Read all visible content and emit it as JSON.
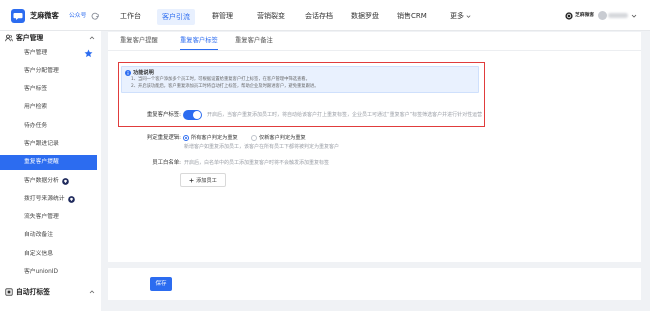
{
  "theme": {
    "accent": "#2c6cf0",
    "accent_light": "#e8f0fe",
    "annotation_red": "#e03c3c",
    "gem_color": "#1f2a5c",
    "notice_bg": "#e9f1fe"
  },
  "app": {
    "logo_icon": "chat-bubble-icon",
    "name": "芝麻微客",
    "badge": "公众号",
    "switch_icon": "switch-icon"
  },
  "header": {
    "nav": [
      {
        "label": "工作台",
        "active": false
      },
      {
        "label": "客户引流",
        "active": true
      },
      {
        "label": "群管理",
        "active": false
      },
      {
        "label": "营销裂变",
        "active": false
      },
      {
        "label": "会话存档",
        "active": false
      },
      {
        "label": "数据罗盘",
        "active": false
      },
      {
        "label": "销售CRM",
        "active": false
      },
      {
        "label": "更多",
        "active": false,
        "icon": "chevron-down-icon"
      }
    ],
    "account": {
      "icon": "org-badge-icon",
      "org_name": "芝麻微客",
      "avatar": "avatar",
      "dropdown_icon": "chevron-down-icon"
    }
  },
  "sidebar": {
    "section": {
      "title": "客户管理",
      "icon": "users-icon",
      "expanded": true,
      "toggle_icon": "chevron-up-icon"
    },
    "items": [
      {
        "label": "客户管理",
        "icon": "star-icon",
        "active": false
      },
      {
        "label": "客户分配管理",
        "active": false
      },
      {
        "label": "客户标签",
        "active": false
      },
      {
        "label": "用户检索",
        "active": false
      },
      {
        "label": "待办任务",
        "active": false
      },
      {
        "label": "客户跟进记录",
        "active": false
      },
      {
        "label": "重复客户提醒",
        "active": true
      },
      {
        "label": "客户数据分析",
        "icon": "gem-icon",
        "active": false
      },
      {
        "label": "拨打号来源统计",
        "icon": "gem-icon",
        "active": false
      },
      {
        "label": "流失客户管理",
        "active": false
      },
      {
        "label": "自动改备注",
        "active": false
      },
      {
        "label": "自定义信息",
        "active": false
      },
      {
        "label": "客户unionID",
        "active": false
      }
    ],
    "section2": {
      "title": "自动打标签",
      "icon": "tag-icon",
      "expanded": false,
      "toggle_icon": "chevron-up-icon"
    }
  },
  "tabs": [
    {
      "label": "重复客户提醒",
      "active": false
    },
    {
      "label": "重复客户标签",
      "active": true
    },
    {
      "label": "重复客户备注",
      "active": false
    }
  ],
  "notice": {
    "icon": "info-icon",
    "title": "功能说明",
    "lines": [
      "1、当同一个客户添加多个员工时，可根据设置给重复客户打上标签，在客户管理中筛选查看。",
      "2、开启该功能后，客户重复添加员工时将自动打上标签，帮助企业及时跟进客户，避免重复跟进。"
    ]
  },
  "form": {
    "tag_toggle": {
      "label": "重复客户标签:",
      "enabled": true,
      "hint": "开启后，当客户重复添加员工时，将自动给该客户打上重复标签，企业员工可通过“重复客户”标签筛选客户并进行针对性运营"
    },
    "logic": {
      "label": "判定重复逻辑:",
      "options": [
        {
          "label": "所有客户判定为重复",
          "selected": true
        },
        {
          "label": "仅新客户判定为重复",
          "selected": false
        }
      ],
      "hint": "新增客户如重复添加员工，该客户在所有员工下都将被判定为重复客户"
    },
    "whitelist": {
      "label": "员工白名单:",
      "hint": "开启后，白名单中的员工添加重复客户时将不会触发添加重复标签",
      "add_icon": "plus-icon",
      "add_label": "添加员工"
    }
  },
  "footer": {
    "save_label": "保存"
  }
}
